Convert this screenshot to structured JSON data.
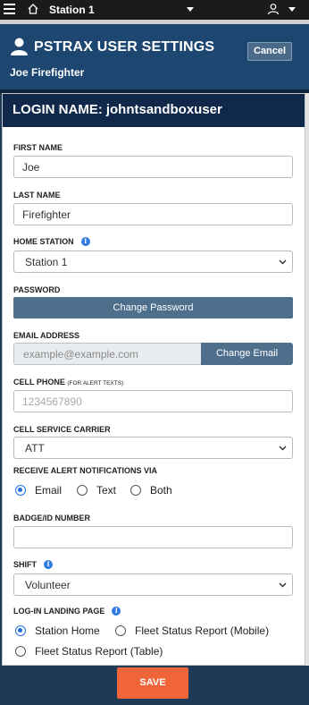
{
  "nav": {
    "station": "Station 1"
  },
  "header": {
    "title": "PSTRAX USER SETTINGS",
    "user_name": "Joe Firefighter",
    "cancel_label": "Cancel"
  },
  "login": {
    "label": "LOGIN NAME:",
    "value": "johntsandboxuser"
  },
  "form": {
    "first_name": {
      "label": "FIRST NAME",
      "value": "Joe"
    },
    "last_name": {
      "label": "LAST NAME",
      "value": "Firefighter"
    },
    "home_station": {
      "label": "HOME STATION",
      "value": "Station 1"
    },
    "password": {
      "label": "PASSWORD",
      "button": "Change Password"
    },
    "email": {
      "label": "EMAIL ADDRESS",
      "placeholder": "example@example.com",
      "button": "Change Email"
    },
    "cell_phone": {
      "label": "CELL PHONE",
      "sublabel": "(FOR ALERT TEXTS)",
      "placeholder": "1234567890"
    },
    "carrier": {
      "label": "CELL SERVICE CARRIER",
      "value": "ATT"
    },
    "alerts": {
      "label": "RECEIVE ALERT NOTIFICATIONS VIA",
      "options": [
        "Email",
        "Text",
        "Both"
      ],
      "selected": "Email"
    },
    "badge": {
      "label": "BADGE/ID NUMBER",
      "value": ""
    },
    "shift": {
      "label": "SHIFT",
      "value": "Volunteer"
    },
    "landing": {
      "label": "LOG-IN LANDING PAGE",
      "options": [
        "Station Home",
        "Fleet Status Report (Mobile)",
        "Fleet Status Report (Table)"
      ],
      "selected": "Station Home"
    }
  },
  "footer": {
    "save_label": "SAVE"
  },
  "colors": {
    "header": "#1d4770",
    "login_bar": "#10284a",
    "button": "#4e6f8c",
    "save": "#f0643a",
    "radio": "#1e6fe0"
  },
  "icons": [
    "hamburger-menu-icon",
    "home-icon",
    "chevron-down-icon",
    "user-icon",
    "info-icon"
  ]
}
